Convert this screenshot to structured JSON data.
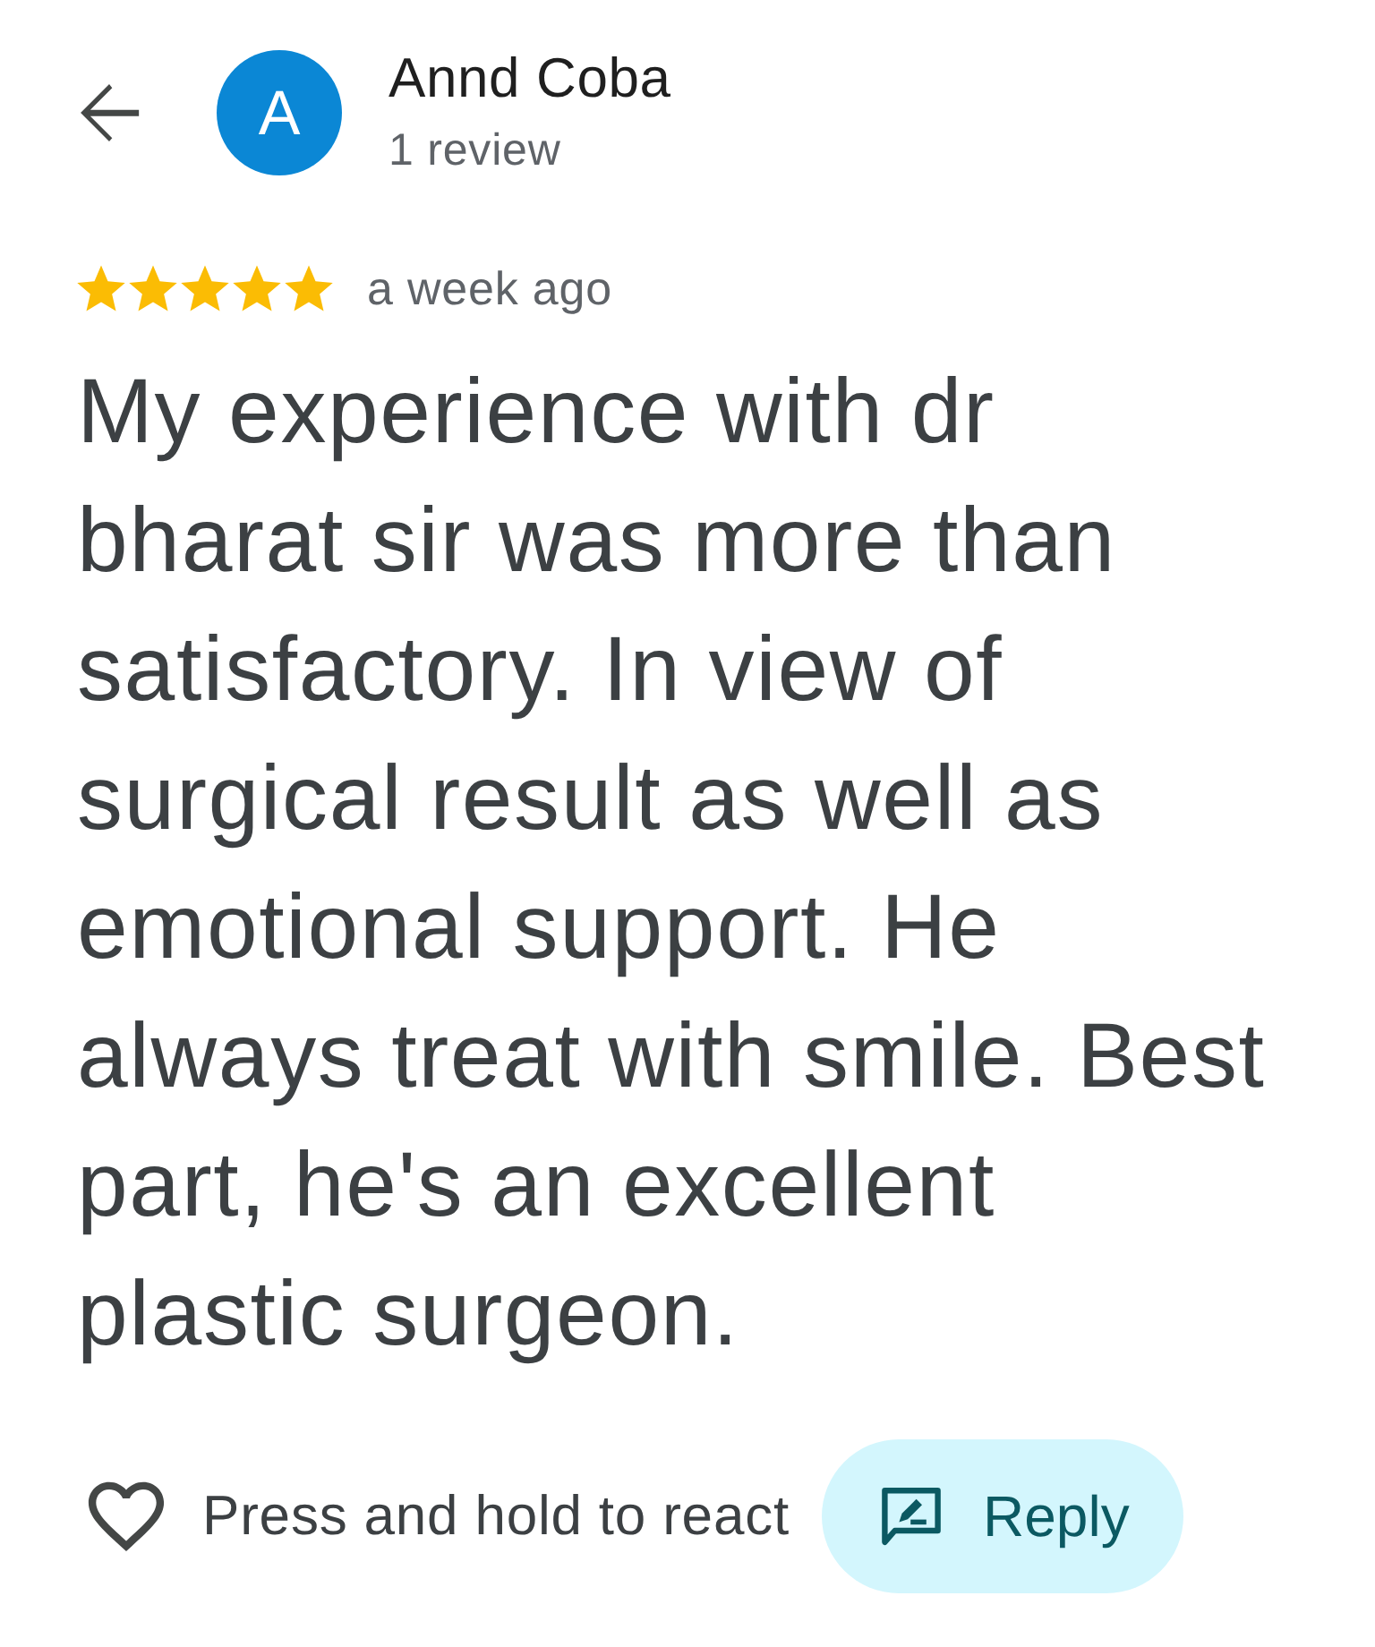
{
  "header": {
    "avatar_letter": "A",
    "author": "Annd Coba",
    "review_count": "1 review"
  },
  "review": {
    "stars": 5,
    "time": "a week ago",
    "text": "My experience with dr bharat sir was more than satisfactory. In view of surgical result as well as emotional support. He always treat with smile. Best part, he's an excellent plastic surgeon."
  },
  "actions": {
    "react_hint": "Press and hold to react",
    "reply_label": "Reply"
  }
}
